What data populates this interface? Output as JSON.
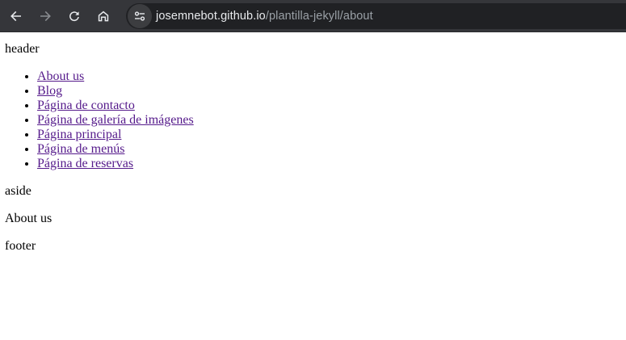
{
  "browser": {
    "url_host": "josemnebot.github.io",
    "url_path": "/plantilla-jekyll/about",
    "colors": {
      "toolbar_bg": "#35363a",
      "omnibox_bg": "#202124",
      "icon_active": "#e8eaed",
      "icon_disabled": "#8a8d91"
    },
    "icons": [
      "back-arrow-icon",
      "forward-arrow-icon",
      "reload-icon",
      "home-icon",
      "site-info-icon"
    ]
  },
  "page": {
    "header_text": "header",
    "nav_links": [
      {
        "label": "About us"
      },
      {
        "label": "Blog"
      },
      {
        "label": "Página de contacto"
      },
      {
        "label": "Página de galería de imágenes"
      },
      {
        "label": "Página principal"
      },
      {
        "label": "Página de menús"
      },
      {
        "label": "Página de reservas"
      }
    ],
    "aside_text": "aside",
    "main_text": "About us",
    "footer_text": "footer",
    "link_color": "#551a8b"
  }
}
